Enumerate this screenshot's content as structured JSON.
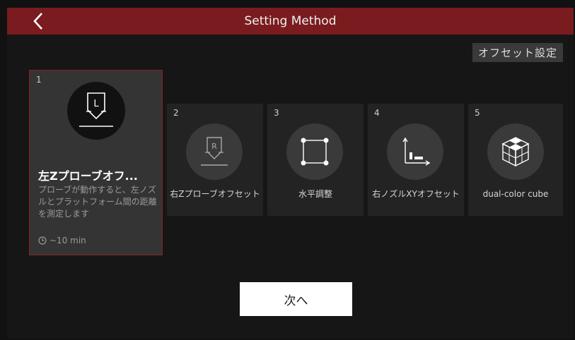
{
  "header": {
    "title": "Setting Method",
    "back_icon": "chevron-left-icon"
  },
  "offset_button": "オフセット設定",
  "cards": [
    {
      "number": "1",
      "title": "左Zプローブオフ...",
      "description": "プローブが動作すると、左ノズルとプラットフォーム間の距離を測定します",
      "time": "~10 min",
      "icon": "probe-L-icon"
    },
    {
      "number": "2",
      "label": "右Zプローブオフセット",
      "icon": "probe-R-icon"
    },
    {
      "number": "3",
      "label": "水平調整",
      "icon": "leveling-square-icon"
    },
    {
      "number": "4",
      "label": "右ノズルXYオフセット",
      "icon": "xy-axis-icon"
    },
    {
      "number": "5",
      "label": "dual-color cube",
      "icon": "cube-icon"
    }
  ],
  "next_button": "次へ",
  "colors": {
    "header": "#7a1c1f",
    "selected_border": "#8a1f22",
    "background": "#161616"
  }
}
